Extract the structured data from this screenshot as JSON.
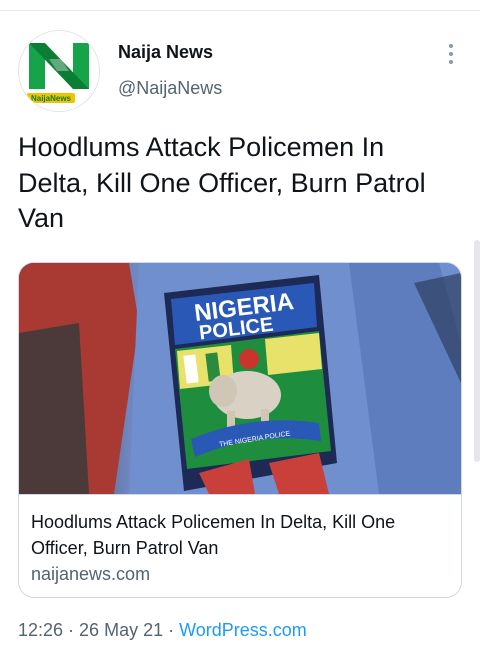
{
  "account": {
    "name": "Naija News",
    "handle": "@NaijaNews",
    "avatar_logo_text": "NaijaNews"
  },
  "tweet": {
    "text": "Hoodlums Attack Policemen In Delta, Kill One Officer, Burn Patrol Van"
  },
  "card": {
    "image_badge_line1": "NIGERIA",
    "image_badge_line2": "POLICE",
    "image_badge_ribbon": "THE NIGERIA POLICE",
    "title": "Hoodlums Attack Policemen In Delta, Kill One Officer, Burn Patrol Van",
    "domain": "naijanews.com"
  },
  "meta": {
    "time": "12:26",
    "separator": " · ",
    "date": "26 May 21",
    "source": "WordPress.com"
  },
  "colors": {
    "link_blue": "#1d9bf0",
    "secondary_text": "#536471",
    "logo_green": "#17a34a"
  },
  "icons": {
    "more": "vertical-ellipsis-icon"
  }
}
